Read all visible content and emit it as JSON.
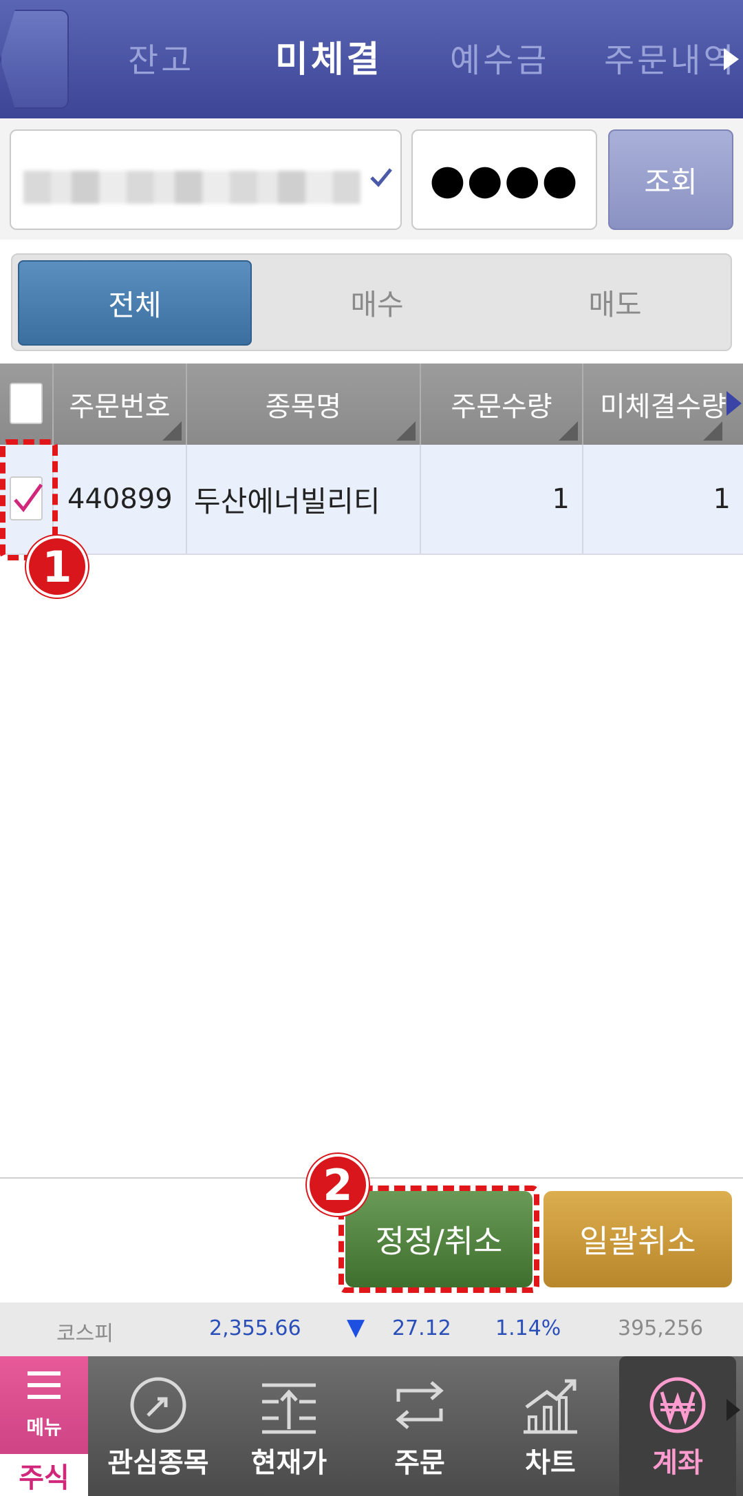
{
  "top_tabs": [
    {
      "label": "잔고"
    },
    {
      "label": "미체결",
      "active": true
    },
    {
      "label": "예수금"
    },
    {
      "label": "주문내역"
    }
  ],
  "account": {
    "password_mask": "●●●●",
    "query_label": "조회"
  },
  "filter": {
    "items": [
      "전체",
      "매수",
      "매도"
    ],
    "active": "전체"
  },
  "table": {
    "headers": [
      "주문번호",
      "종목명",
      "주문수량",
      "미체결수량"
    ],
    "rows": [
      {
        "order_no": "440899",
        "name": "두산에너빌리티",
        "qty": "1",
        "unfilled": "1",
        "checked": true
      }
    ]
  },
  "annotations": {
    "step1": "1",
    "step2": "2"
  },
  "actions": {
    "edit_cancel": "정정/취소",
    "cancel_all": "일괄취소"
  },
  "ticker": {
    "index_name": "코스피",
    "value": "2,355.66",
    "direction": "▼",
    "change": "27.12",
    "percent": "1.14%",
    "volume": "395,256",
    "colors": {
      "value": "#2b4fb8",
      "down": "#1d4fe0",
      "muted": "#8a8a8a"
    }
  },
  "nav": {
    "menu_label": "메뉴",
    "section_label": "주식",
    "items": [
      "관심종목",
      "현재가",
      "주문",
      "차트",
      "계좌"
    ],
    "active": "계좌"
  },
  "colors": {
    "header_blue": "#4a54a3",
    "accent_pink": "#d0277a",
    "edit_green": "#4e7f3c",
    "cancel_gold": "#c9973a",
    "annotation_red": "#e0161b"
  }
}
